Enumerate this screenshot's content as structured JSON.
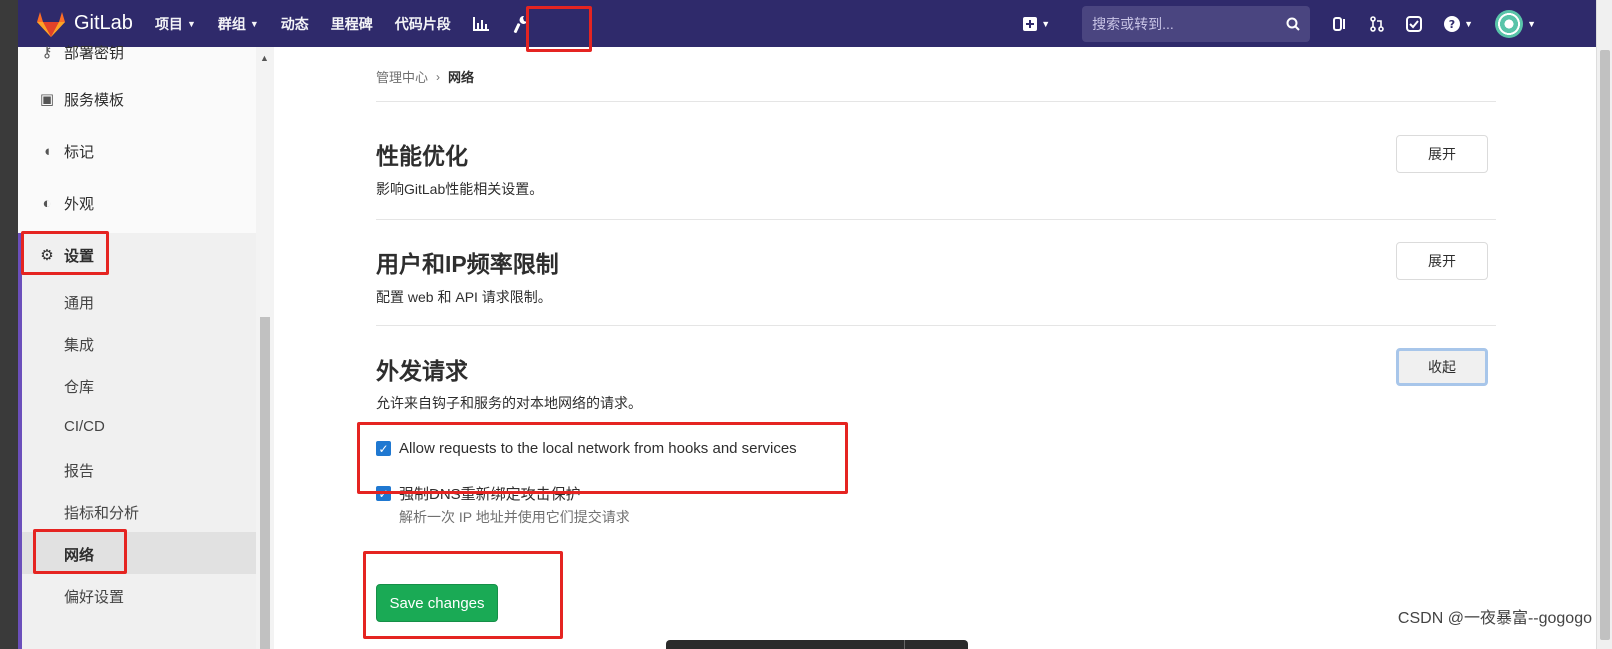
{
  "navbar": {
    "brand": "GitLab",
    "items": [
      {
        "label": "项目",
        "caret": true
      },
      {
        "label": "群组",
        "caret": true
      },
      {
        "label": "动态",
        "caret": false
      },
      {
        "label": "里程碑",
        "caret": false
      },
      {
        "label": "代码片段",
        "caret": false
      }
    ],
    "search_placeholder": "搜索或转到..."
  },
  "sidebar": {
    "top_items": [
      {
        "label": "部署密钥",
        "icon": "key-icon"
      },
      {
        "label": "服务模板",
        "icon": "template-icon"
      },
      {
        "label": "标记",
        "icon": "labels-icon"
      },
      {
        "label": "外观",
        "icon": "palette-icon"
      }
    ],
    "settings_label": "设置",
    "sub_items": [
      "通用",
      "集成",
      "仓库",
      "CI/CD",
      "报告",
      "指标和分析",
      "网络",
      "偏好设置"
    ],
    "active_sub": "网络"
  },
  "breadcrumb": {
    "parent": "管理中心",
    "current": "网络"
  },
  "sections": [
    {
      "title": "性能优化",
      "desc": "影响GitLab性能相关设置。",
      "button": "展开"
    },
    {
      "title": "用户和IP频率限制",
      "desc": "配置 web 和 API 请求限制。",
      "button": "展开"
    },
    {
      "title": "外发请求",
      "desc": "允许来自钩子和服务的对本地网络的请求。",
      "button": "收起"
    }
  ],
  "checkboxes": [
    {
      "label": "Allow requests to the local network from hooks and services",
      "checked": true
    },
    {
      "label": "强制DNS重新绑定攻击保护",
      "checked": true,
      "help": "解析一次 IP 地址并使用它们提交请求"
    }
  ],
  "save_button": "Save changes",
  "watermark": "CSDN @一夜暴富--gogogo",
  "colors": {
    "navbar": "#2f2a6b",
    "accent": "#6b4fbb",
    "save": "#1aaa55",
    "checkbox": "#1f78d1",
    "highlight": "#e52421"
  }
}
